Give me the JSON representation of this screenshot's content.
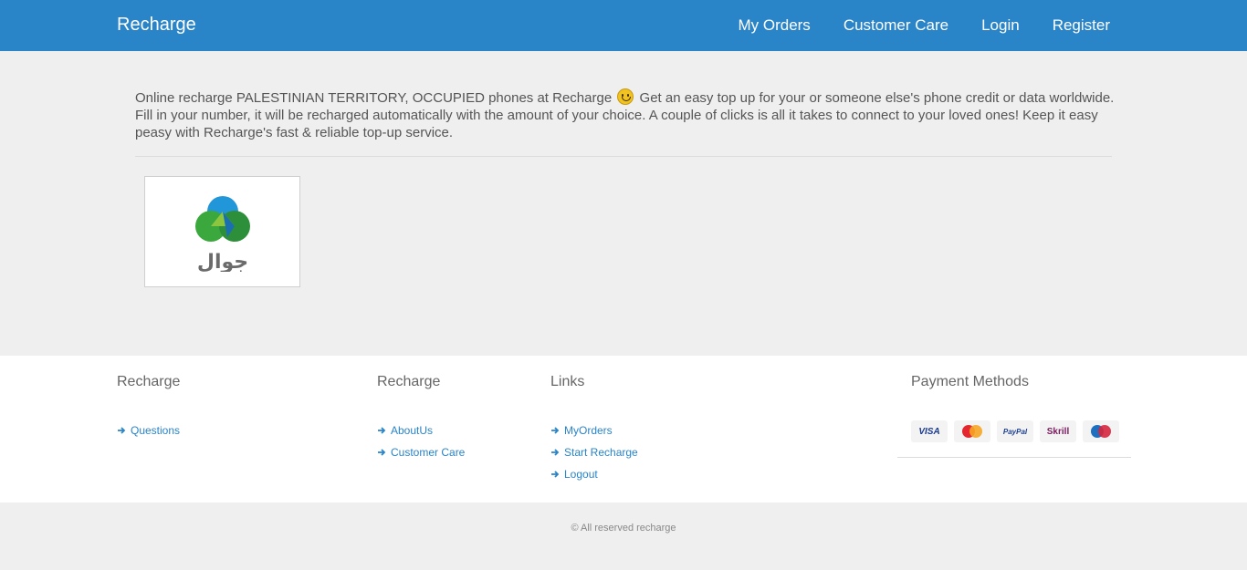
{
  "header": {
    "brand": "Recharge",
    "nav": {
      "my_orders": "My Orders",
      "customer_care": "Customer Care",
      "login": "Login",
      "register": "Register"
    }
  },
  "main": {
    "intro_before": "Online recharge PALESTINIAN TERRITORY, OCCUPIED phones at Recharge",
    "intro_after": "Get an easy top up for your or someone else's phone credit or data worldwide. Fill in your number, it will be recharged automatically with the amount of your choice. A couple of clicks is all it takes to connect to your loved ones! Keep it easy peasy with Recharge's fast & reliable top-up service.",
    "operator": {
      "logo_text": "جوال"
    }
  },
  "footer": {
    "col1": {
      "title": "Recharge",
      "links": [
        "Questions"
      ]
    },
    "col2": {
      "title": "Recharge",
      "links": [
        "AboutUs",
        "Customer Care"
      ]
    },
    "col3": {
      "title": "Links",
      "links": [
        "MyOrders",
        "Start Recharge",
        "Logout"
      ]
    },
    "payments": {
      "title": "Payment Methods",
      "visa": "VISA",
      "paypal": "PayPal",
      "skrill": "Skrill"
    },
    "copyright": "© All reserved recharge"
  },
  "colors": {
    "primary": "#2a84c8",
    "background": "#efefef"
  }
}
